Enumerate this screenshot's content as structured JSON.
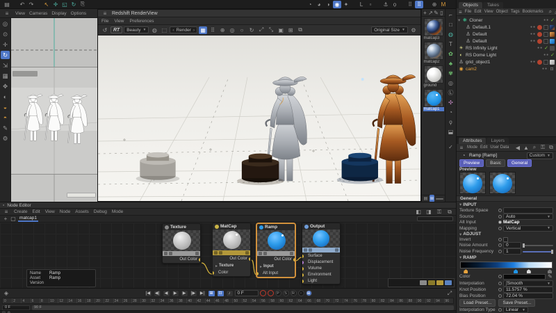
{
  "colors": {
    "accent": "#4f78c8",
    "selection_orange": "#d2913c",
    "wire_yellow": "#d9b63e",
    "matcap_bar": "#b3983a",
    "output_bar": "#8faccd",
    "ramp_blue": "#2196e8",
    "tag_red": "#b5432f",
    "check_green": "#7ec641"
  },
  "viewport": {
    "menu": [
      "View",
      "Cameras",
      "Display",
      "Options"
    ]
  },
  "renderview": {
    "title": "Redshift RenderView",
    "menu": [
      "File",
      "View",
      "Preferences"
    ],
    "toolbar": {
      "rt": "RT",
      "pass": "Beauty",
      "bucket": "Render",
      "size": "Original Size"
    }
  },
  "materials": {
    "items": [
      {
        "name": "matcap3"
      },
      {
        "name": "matcap2"
      },
      {
        "name": "ground"
      },
      {
        "name": "matcap1"
      }
    ]
  },
  "objects": {
    "tabs": [
      "Objects",
      "Takes"
    ],
    "menu": [
      "File",
      "Edit",
      "View",
      "Object",
      "Tags",
      "Bookmarks"
    ],
    "tree": [
      {
        "label": "Cloner"
      },
      {
        "label": "Default.1"
      },
      {
        "label": "Default"
      },
      {
        "label": "Default"
      },
      {
        "label": "RS Infinity Light"
      },
      {
        "label": "RS Dome Light"
      },
      {
        "label": "grid_object1"
      },
      {
        "label": "cam2"
      }
    ]
  },
  "attributes": {
    "tabs": [
      "Attributes",
      "Layers"
    ],
    "menu": [
      "Mode",
      "Edit",
      "User Data"
    ],
    "object_label": "Ramp [Ramp]",
    "preset": "Custom",
    "view_buttons": [
      "Preview",
      "Basic",
      "General"
    ],
    "preview_label": "Preview",
    "general_label": "General",
    "groups": {
      "input": {
        "title": "INPUT",
        "rows": {
          "texture_space": {
            "label": "Texture Space",
            "value": ""
          },
          "source": {
            "label": "Source",
            "value": "Auto"
          },
          "alt_input": {
            "label": "Alt Input",
            "value": "MatCap"
          },
          "mapping": {
            "label": "Mapping",
            "value": "Vertical"
          }
        }
      },
      "adjust": {
        "title": "ADJUST",
        "rows": {
          "invert": {
            "label": "Invert"
          },
          "noise_amount": {
            "label": "Noise Amount",
            "value": "0"
          },
          "noise_frequency": {
            "label": "Noise Frequency",
            "value": "1"
          }
        }
      },
      "ramp": {
        "title": "RAMP",
        "rows": {
          "color": {
            "label": "Color"
          },
          "interpolation": {
            "label": "Interpolation",
            "value": "Smooth"
          },
          "knot_position": {
            "label": "Knot Position",
            "value": "11.5757 %"
          },
          "bias_position": {
            "label": "Bias Position",
            "value": "72.04 %"
          },
          "interpolation_type": {
            "label": "Interpolation Type",
            "value": "Linear"
          }
        },
        "buttons": [
          "Load Preset...",
          "Save Preset..."
        ]
      }
    }
  },
  "node_editor": {
    "title": "Node Editor",
    "menu": [
      "Create",
      "Edit",
      "View",
      "Node",
      "Assets",
      "Debug",
      "Mode"
    ],
    "tab": "matcap1",
    "nodes": {
      "texture": {
        "title": "Texture",
        "out": "Out Color"
      },
      "matcap": {
        "title": "MatCap",
        "out": "Out Color",
        "inputs": [
          "Texture",
          "Color"
        ]
      },
      "ramp": {
        "title": "Ramp",
        "out": "Out Color",
        "inputs": [
          "Input",
          "Alt Input"
        ]
      },
      "output": {
        "title": "Output",
        "inputs": [
          "Surface",
          "Displacement",
          "Volume",
          "Environment",
          "Light"
        ]
      }
    },
    "tooltip": {
      "name_label": "Name",
      "name": "Ramp",
      "asset_label": "Asset",
      "asset": "Ramp",
      "version_label": "Version",
      "version": ""
    }
  },
  "timeline": {
    "current_frame": "0 F",
    "range_start": "0 F",
    "range_end": "90 F",
    "ruler": {
      "start": 0,
      "end": 96,
      "step": 2
    }
  }
}
